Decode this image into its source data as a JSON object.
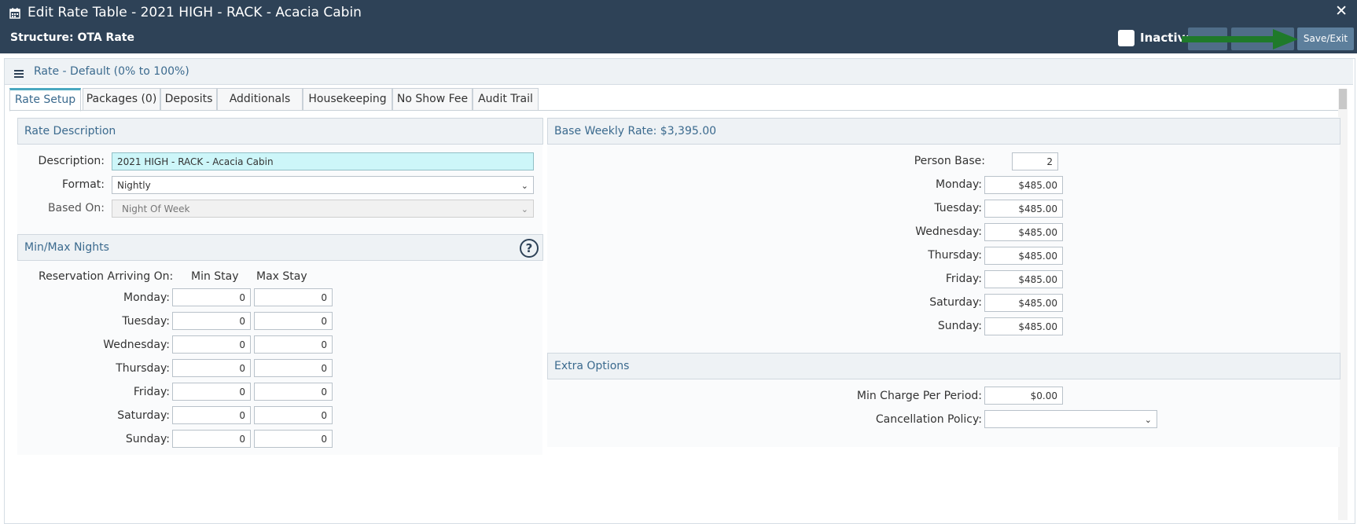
{
  "header": {
    "title": "Edit Rate Table - 2021 HIGH - RACK - Acacia Cabin",
    "close_label": "✕",
    "structure": "Structure: OTA Rate",
    "inactive_label": "Inactive",
    "save_label": "Save/Exit"
  },
  "rate_header": "Rate - Default (0% to 100%)",
  "tabs": [
    "Rate Setup",
    "Packages (0)",
    "Deposits",
    "Additionals",
    "Housekeeping",
    "No Show Fee",
    "Audit Trail"
  ],
  "rate_description": {
    "title": "Rate Description",
    "description_label": "Description:",
    "description_value": "2021 HIGH - RACK - Acacia Cabin",
    "format_label": "Format:",
    "format_value": "Nightly",
    "based_on_label": "Based On:",
    "based_on_value": "Night Of Week"
  },
  "min_max": {
    "title": "Min/Max Nights",
    "help": "?",
    "arriving_label": "Reservation Arriving On:",
    "min_label": "Min Stay",
    "max_label": "Max Stay",
    "rows": [
      {
        "day": "Monday:",
        "min": "0",
        "max": "0"
      },
      {
        "day": "Tuesday:",
        "min": "0",
        "max": "0"
      },
      {
        "day": "Wednesday:",
        "min": "0",
        "max": "0"
      },
      {
        "day": "Thursday:",
        "min": "0",
        "max": "0"
      },
      {
        "day": "Friday:",
        "min": "0",
        "max": "0"
      },
      {
        "day": "Saturday:",
        "min": "0",
        "max": "0"
      },
      {
        "day": "Sunday:",
        "min": "0",
        "max": "0"
      }
    ]
  },
  "base_weekly": {
    "title": "Base Weekly Rate: $3,395.00",
    "person_base_label": "Person Base:",
    "person_base_value": "2",
    "days": [
      {
        "day": "Monday:",
        "rate": "$485.00"
      },
      {
        "day": "Tuesday:",
        "rate": "$485.00"
      },
      {
        "day": "Wednesday:",
        "rate": "$485.00"
      },
      {
        "day": "Thursday:",
        "rate": "$485.00"
      },
      {
        "day": "Friday:",
        "rate": "$485.00"
      },
      {
        "day": "Saturday:",
        "rate": "$485.00"
      },
      {
        "day": "Sunday:",
        "rate": "$485.00"
      }
    ]
  },
  "extra_options": {
    "title": "Extra Options",
    "min_charge_label": "Min Charge Per Period:",
    "min_charge_value": "$0.00",
    "cancellation_label": "Cancellation Policy:",
    "cancellation_value": ""
  },
  "colors": {
    "header_bg": "#2e4257",
    "accent": "#4aa8c0",
    "arrow": "#1f7a2a"
  }
}
